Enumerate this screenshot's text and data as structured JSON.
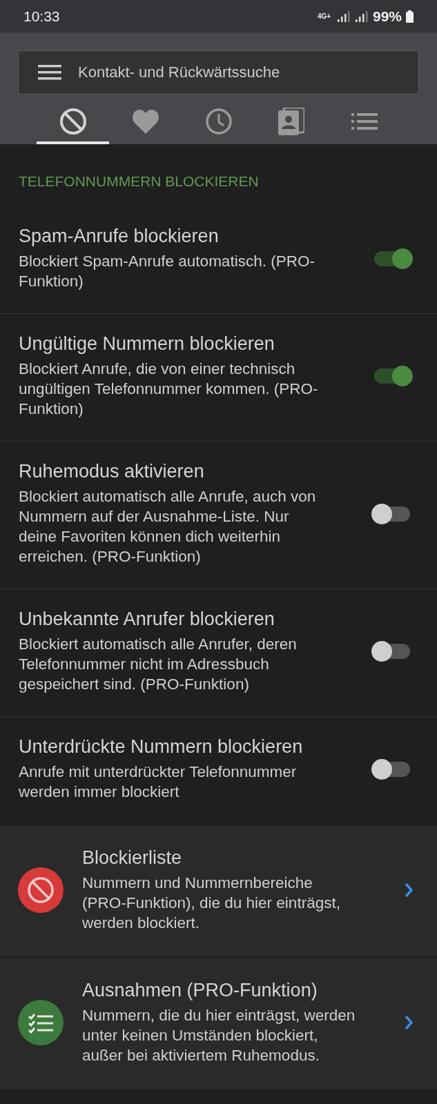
{
  "status_bar": {
    "time": "10:33",
    "network": "4G+",
    "battery": "99%"
  },
  "search": {
    "placeholder": "Kontakt- und Rückwärtssuche"
  },
  "tabs": [
    {
      "kind": "block",
      "selected": true
    },
    {
      "kind": "heart",
      "selected": false
    },
    {
      "kind": "clock",
      "selected": false
    },
    {
      "kind": "contacts",
      "selected": false
    },
    {
      "kind": "list",
      "selected": false
    }
  ],
  "section": {
    "title": "TELEFONNUMMERN BLOCKIEREN"
  },
  "settings": [
    {
      "title": "Spam-Anrufe blockieren",
      "description": "Blockiert Spam-Anrufe automatisch. (PRO-Funktion)",
      "on": true
    },
    {
      "title": "Ungültige Nummern blockieren",
      "description": "Blockiert Anrufe, die von einer technisch ungültigen Telefonnummer kommen. (PRO-Funktion)",
      "on": true
    },
    {
      "title": "Ruhemodus aktivieren",
      "description": "Blockiert automatisch alle Anrufe, auch von Nummern auf der Ausnahme-Liste. Nur deine Favoriten können dich weiterhin erreichen. (PRO-Funktion)",
      "on": false
    },
    {
      "title": "Unbekannte Anrufer blockieren",
      "description": "Blockiert automatisch alle Anrufer, deren Telefonnummer nicht im Adressbuch gespeichert sind. (PRO-Funktion)",
      "on": false
    },
    {
      "title": "Unterdrückte Nummern blockieren",
      "description": "Anrufe mit unterdrückter Telefonnummer werden immer blockiert",
      "on": false
    }
  ],
  "links": [
    {
      "kind": "block",
      "color": "#d83a3a",
      "title": "Blockierliste",
      "description": "Nummern und Nummernbereiche (PRO-Funktion), die du hier einträgst, werden blockiert."
    },
    {
      "kind": "list",
      "color": "#3d7a3d",
      "title": "Ausnahmen (PRO-Funktion)",
      "description": "Nummern, die du hier einträgst, werden unter keinen Umständen blockiert, außer bei aktiviertem Ruhemodus."
    }
  ]
}
